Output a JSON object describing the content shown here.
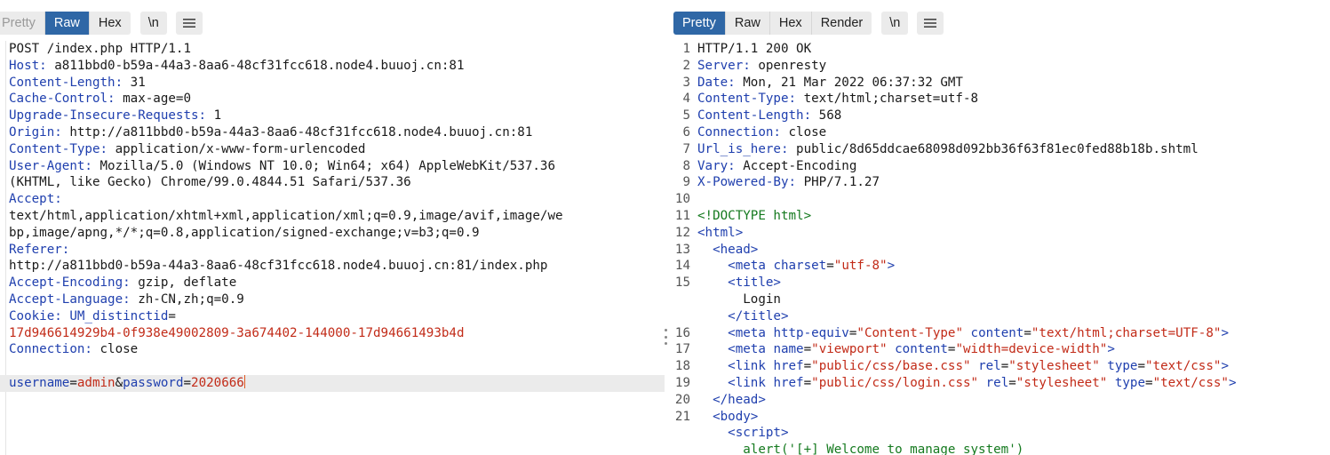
{
  "request": {
    "tabs": [
      {
        "label": "Pretty",
        "active": false
      },
      {
        "label": "Raw",
        "active": true
      },
      {
        "label": "Hex",
        "active": false
      }
    ],
    "newline_toggle": "\\n",
    "menu_icon": "hamburger-menu-icon",
    "request_line": "POST /index.php HTTP/1.1",
    "headers": [
      {
        "key": "Host:",
        "value": " a811bbd0-b59a-44a3-8aa6-48cf31fcc618.node4.buuoj.cn:81"
      },
      {
        "key": "Content-Length:",
        "value": " 31"
      },
      {
        "key": "Cache-Control:",
        "value": " max-age=0"
      },
      {
        "key": "Upgrade-Insecure-Requests:",
        "value": " 1"
      },
      {
        "key": "Origin:",
        "value": " http://a811bbd0-b59a-44a3-8aa6-48cf31fcc618.node4.buuoj.cn:81"
      },
      {
        "key": "Content-Type:",
        "value": " application/x-www-form-urlencoded"
      },
      {
        "key": "User-Agent:",
        "value": " Mozilla/5.0 (Windows NT 10.0; Win64; x64) AppleWebKit/537.36"
      }
    ],
    "ua_cont": "(KHTML, like Gecko) Chrome/99.0.4844.51 Safari/537.36",
    "accept_key": "Accept:",
    "accept_value_1": "text/html,application/xhtml+xml,application/xml;q=0.9,image/avif,image/we",
    "accept_value_2": "bp,image/apng,*/*;q=0.8,application/signed-exchange;v=b3;q=0.9",
    "referer_key": "Referer:",
    "referer_value": "http://a811bbd0-b59a-44a3-8aa6-48cf31fcc618.node4.buuoj.cn:81/index.php",
    "accept_encoding_key": "Accept-Encoding:",
    "accept_encoding_value": " gzip, deflate",
    "accept_language_key": "Accept-Language:",
    "accept_language_value": " zh-CN,zh;q=0.9",
    "cookie_key": "Cookie:",
    "cookie_name": " UM_distinctid",
    "cookie_eq": "=",
    "cookie_value": "17d946614929b4-0f938e49002809-3a674402-144000-17d94661493b4d",
    "connection_key": "Connection:",
    "connection_value": " close",
    "body": {
      "p1": "username",
      "eq1": "=",
      "v1": "admin",
      "amp": "&",
      "p2": "password",
      "eq2": "=",
      "v2": "2020666"
    }
  },
  "response": {
    "tabs": [
      {
        "label": "Pretty",
        "active": true
      },
      {
        "label": "Raw",
        "active": false
      },
      {
        "label": "Hex",
        "active": false
      },
      {
        "label": "Render",
        "active": false
      }
    ],
    "newline_toggle": "\\n",
    "menu_icon": "hamburger-menu-icon",
    "lines": {
      "n1": "1",
      "n2": "2",
      "n3": "3",
      "n4": "4",
      "n5": "5",
      "n6": "6",
      "n7": "7",
      "n8": "8",
      "n9": "9",
      "n10": "10",
      "n11": "11",
      "n12": "12",
      "n13": "13",
      "n14": "14",
      "n15": "15",
      "n16": "16",
      "n17": "17",
      "n18": "18",
      "n19": "19",
      "n20": "20",
      "n21": "21"
    },
    "status": "HTTP/1.1 200 OK",
    "headers": [
      {
        "key": "Server:",
        "value": " openresty"
      },
      {
        "key": "Date:",
        "value": " Mon, 21 Mar 2022 06:37:32 GMT"
      },
      {
        "key": "Content-Type:",
        "value": " text/html;charset=utf-8"
      },
      {
        "key": "Content-Length:",
        "value": " 568"
      },
      {
        "key": "Connection:",
        "value": " close"
      },
      {
        "key": "Url_is_here:",
        "value": " public/8d65ddcae68098d092bb36f63f81ec0fed88b18b.shtml"
      },
      {
        "key": "Vary:",
        "value": " Accept-Encoding"
      },
      {
        "key": "X-Powered-By:",
        "value": " PHP/7.1.27"
      }
    ],
    "html": {
      "doctype": "<!DOCTYPE html>",
      "html_open": "<html>",
      "head_open": "<head>",
      "meta_tag": "<meta",
      "charset_attr": "charset",
      "charset_val": "\"utf-8\"",
      "gt": ">",
      "title_open": "<title>",
      "title_text": "Login",
      "title_close": "</title>",
      "http_equiv_attr": "http-equiv",
      "http_equiv_val": "\"Content-Type\"",
      "content_attr": "content",
      "content_val_1": "\"text/html;charset=UTF-8\"",
      "name_attr": "name",
      "name_val": "\"viewport\"",
      "content_val_2": "\"width=device-width\"",
      "link_tag": "<link",
      "href_attr": "href",
      "href_base": "\"public/css/base.css\"",
      "href_login": "\"public/css/login.css\"",
      "rel_attr": "rel",
      "rel_val": "\"stylesheet\"",
      "type_attr": "type",
      "type_val": "\"text/css\"",
      "head_close": "</head>",
      "body_open": "<body>",
      "script_open": "<script>",
      "alert_text": "alert('[+] Welcome to manage system')",
      "eq": "="
    }
  }
}
